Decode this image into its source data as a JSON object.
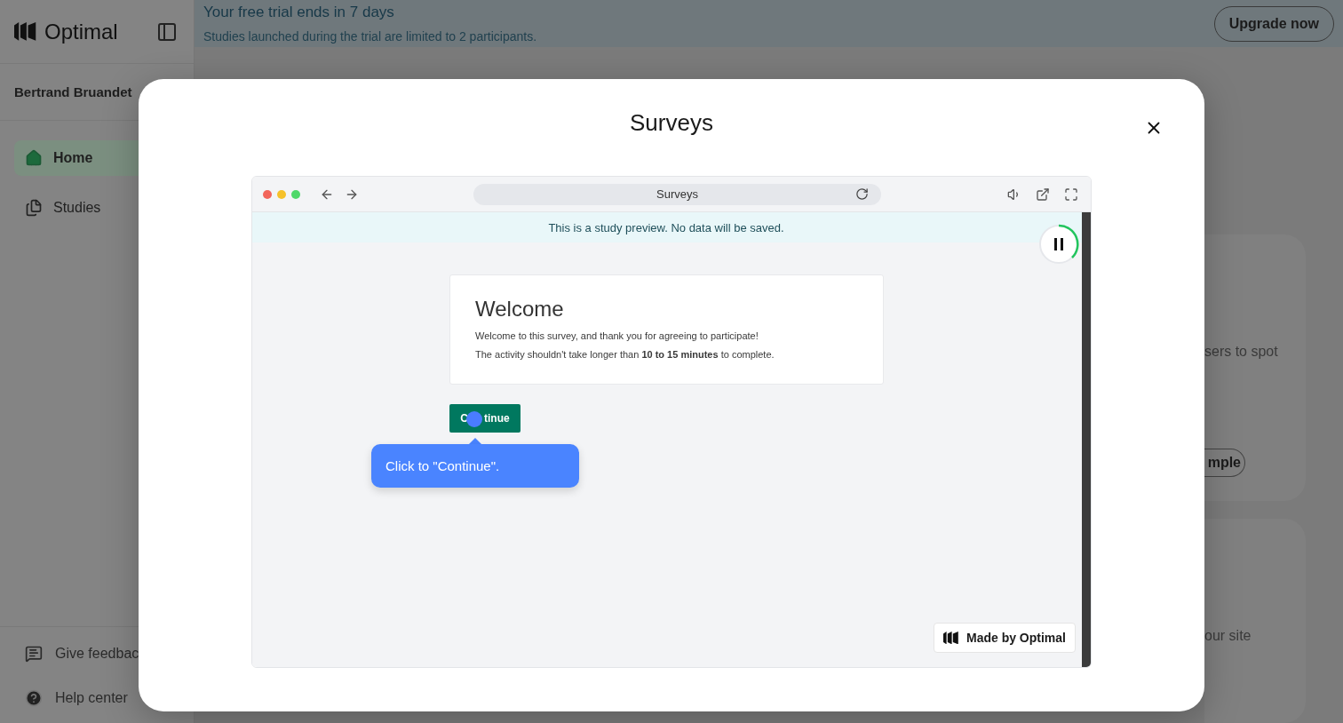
{
  "app": {
    "logo": "Optimal"
  },
  "trial_banner": {
    "title": "Your free trial ends in 7 days",
    "message": "Studies launched during the trial are limited to 2 participants.",
    "button": "Upgrade now"
  },
  "sidebar": {
    "user": "Bertrand Bruandet",
    "items": [
      {
        "label": "Home",
        "selected": true
      },
      {
        "label": "Studies",
        "selected": false
      }
    ],
    "footer": [
      {
        "label": "Give feedbac"
      },
      {
        "label": "Help center"
      }
    ]
  },
  "background_cards": [
    {
      "text": "sers to spot",
      "button": "mple"
    },
    {
      "text": "our site"
    }
  ],
  "modal": {
    "title": "Surveys",
    "browser": {
      "address": "Surveys",
      "preview_notice": "This is a study preview. No data will be saved.",
      "welcome": {
        "heading": "Welcome",
        "lines": [
          "Welcome to this survey, and thank you for agreeing to participate!",
          "The activity shouldn't take longer than **10 to 15 minutes** to complete."
        ]
      },
      "continue_button": {
        "text_before_cursor": "C",
        "text_after_cursor": "tinue"
      },
      "tooltip": "Click to \"Continue\".",
      "badge": "Made by Optimal"
    }
  }
}
